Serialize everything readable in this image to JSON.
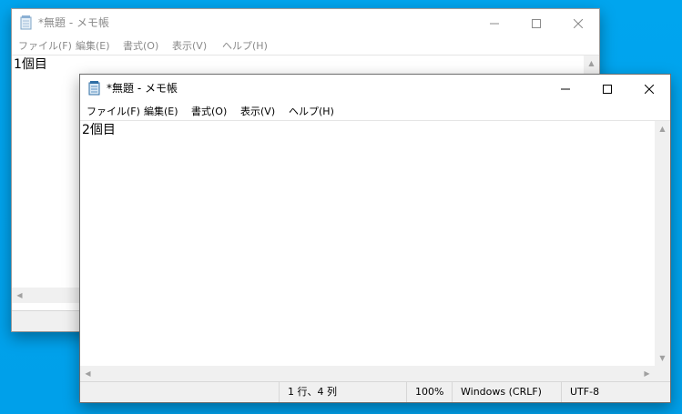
{
  "windows": [
    {
      "title": "*無題 - メモ帳",
      "menu": [
        "ファイル(F)",
        "編集(E)",
        "書式(O)",
        "表示(V)",
        "ヘルプ(H)"
      ],
      "content": "1個目",
      "active": false
    },
    {
      "title": "*無題 - メモ帳",
      "menu": [
        "ファイル(F)",
        "編集(E)",
        "書式(O)",
        "表示(V)",
        "ヘルプ(H)"
      ],
      "content": "2個目",
      "active": true,
      "status": {
        "position": "1 行、4 列",
        "zoom": "100%",
        "line_ending": "Windows (CRLF)",
        "encoding": "UTF-8"
      }
    }
  ],
  "icons": {
    "app": "notepad-icon",
    "minimize": "minimize-icon",
    "maximize": "maximize-icon",
    "close": "close-icon",
    "scroll_up": "chevron-up-icon",
    "scroll_down": "chevron-down-icon",
    "scroll_left": "chevron-left-icon",
    "scroll_right": "chevron-right-icon"
  },
  "colors": {
    "desktop": "#00a2ed",
    "inactive_text": "#8a8a8a",
    "statusbar_bg": "#f0f0f0"
  }
}
